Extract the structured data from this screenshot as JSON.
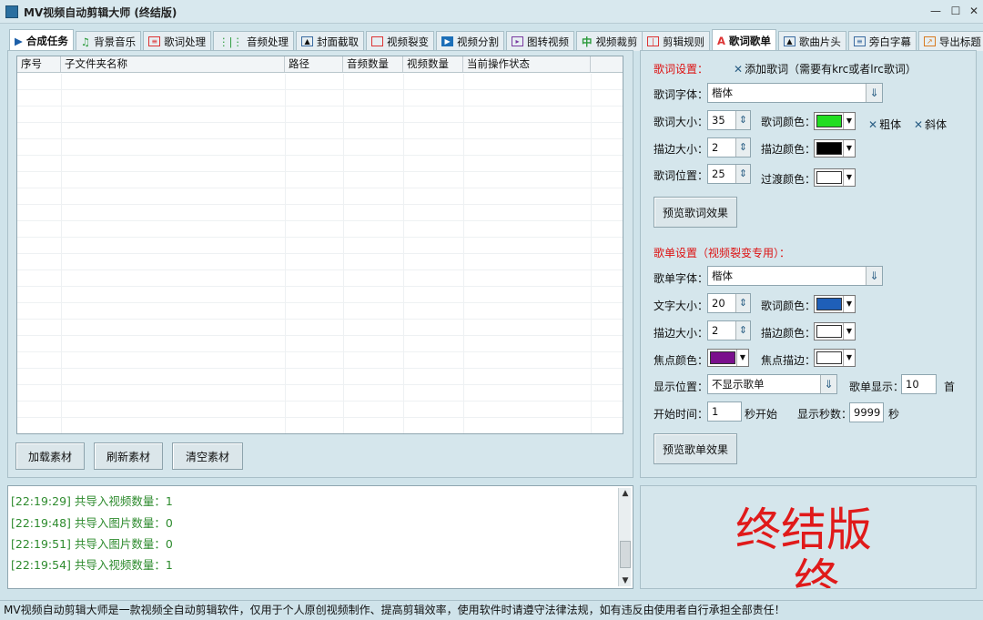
{
  "window": {
    "title": "MV视频自动剪辑大师 (终结版)",
    "minimize": "—",
    "maximize": "☐",
    "close": "✕"
  },
  "left_tabs": [
    {
      "label": "合成任务",
      "icon": "play-icon"
    },
    {
      "label": "背景音乐",
      "icon": "music-note-icon"
    },
    {
      "label": "歌词处理",
      "icon": "lyrics-icon"
    },
    {
      "label": "音频处理",
      "icon": "waveform-icon"
    },
    {
      "label": "封面截取",
      "icon": "image-icon"
    },
    {
      "label": "视频裂变",
      "icon": "copy-icon"
    },
    {
      "label": "视频分割",
      "icon": "video-play-icon"
    },
    {
      "label": "图转视频",
      "icon": "slideshow-icon"
    },
    {
      "label": "视频裁剪",
      "icon": "crop-icon"
    }
  ],
  "table": {
    "columns": [
      "序号",
      "子文件夹名称",
      "路径",
      "音频数量",
      "视频数量",
      "当前操作状态"
    ]
  },
  "buttons": {
    "load": "加载素材",
    "refresh": "刷新素材",
    "clear": "清空素材"
  },
  "log": [
    "[22:19:29] 共导入视频数量：1",
    "[22:19:48] 共导入图片数量：0",
    "[22:19:51] 共导入图片数量：0",
    "[22:19:54] 共导入视频数量：1"
  ],
  "right_tabs": [
    {
      "label": "剪辑规则",
      "icon": "rules-icon"
    },
    {
      "label": "歌词歌单",
      "icon": "text-a-icon"
    },
    {
      "label": "歌曲片头",
      "icon": "image-icon"
    },
    {
      "label": "旁白字幕",
      "icon": "subtitle-icon"
    },
    {
      "label": "导出标题",
      "icon": "export-icon"
    }
  ],
  "lyrics": {
    "section_label": "歌词设置：",
    "add_lyrics": "添加歌词（需要有krc或者lrc歌词）",
    "font_label": "歌词字体：",
    "font_value": "楷体",
    "size_label": "歌词大小：",
    "size_value": "35",
    "color_label": "歌词颜色：",
    "color": "#22dd22",
    "bold": "粗体",
    "italic": "斜体",
    "stroke_size_label": "描边大小：",
    "stroke_size_value": "2",
    "stroke_color_label": "描边颜色：",
    "stroke_color": "#000000",
    "position_label": "歌词位置：",
    "position_value": "25",
    "transition_color_label": "过渡颜色：",
    "transition_color": "#ffffff",
    "preview_button": "预览歌词效果"
  },
  "playlist": {
    "section_label": "歌单设置（视频裂变专用）：",
    "font_label": "歌单字体：",
    "font_value": "楷体",
    "text_size_label": "文字大小：",
    "text_size_value": "20",
    "color_label": "歌词颜色：",
    "color": "#1f5fb8",
    "stroke_size_label": "描边大小：",
    "stroke_size_value": "2",
    "stroke_color_label": "描边颜色：",
    "stroke_color": "#ffffff",
    "focus_color_label": "焦点颜色：",
    "focus_color": "#7a0f8c",
    "focus_stroke_label": "焦点描边：",
    "focus_stroke_color": "#ffffff",
    "display_position_label": "显示位置：",
    "display_position_value": "不显示歌单",
    "display_count_label": "歌单显示：",
    "display_count_value": "10",
    "display_count_unit": "首",
    "start_time_label": "开始时间：",
    "start_time_value": "1",
    "start_time_unit": "秒开始",
    "show_seconds_label": "显示秒数：",
    "show_seconds_value": "9999",
    "show_seconds_unit": "秒",
    "preview_button": "预览歌单效果"
  },
  "preview": {
    "line1": "终结版",
    "line2": "终"
  },
  "status": "MV视频自动剪辑大师是一款视频全自动剪辑软件，仅用于个人原创视频制作、提高剪辑效率，使用软件时请遵守法律法规，如有违反由使用者自行承担全部责任！"
}
